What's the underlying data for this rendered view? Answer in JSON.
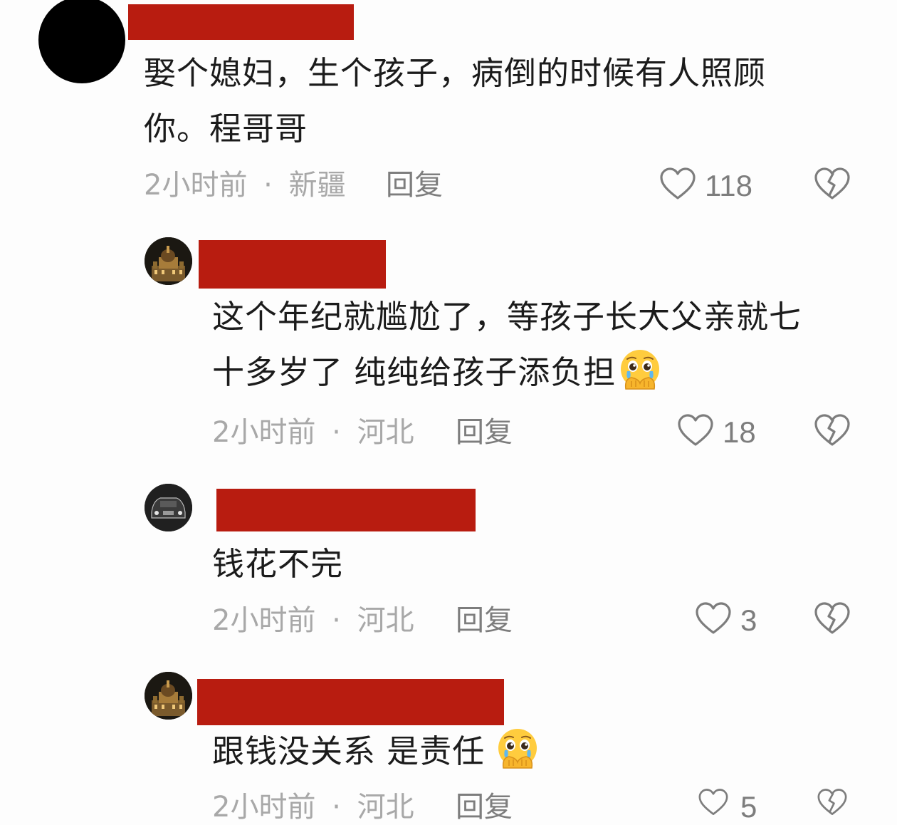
{
  "comments": [
    {
      "text_line1": "娶个媳妇，生个孩子，病倒的时候有人照顾",
      "text_line2": "你。程哥哥",
      "time": "2小时前",
      "location": "新疆",
      "reply_label": "回复",
      "likes": "118",
      "emoji": ""
    },
    {
      "text_line1": "这个年纪就尴尬了，等孩子长大父亲就七",
      "text_line2": "十多岁了 纯纯给孩子添负担",
      "time": "2小时前",
      "location": "河北",
      "reply_label": "回复",
      "likes": "18",
      "emoji": "pleading-face-emoji"
    },
    {
      "text_line1": "钱花不完",
      "time": "2小时前",
      "location": "河北",
      "reply_label": "回复",
      "likes": "3"
    },
    {
      "text_line1": "跟钱没关系 是责任",
      "time": "2小时前",
      "location": "河北",
      "reply_label": "回复",
      "likes": "5",
      "emoji": "pleading-face-emoji"
    }
  ],
  "meta_separator": "·",
  "icons": {
    "like": "heart-outline-icon",
    "dislike": "broken-heart-icon"
  },
  "colors": {
    "redaction": "#b81c10",
    "text": "#1b1b1b",
    "meta": "#a8a8a8",
    "reply": "#7d7d7d"
  }
}
